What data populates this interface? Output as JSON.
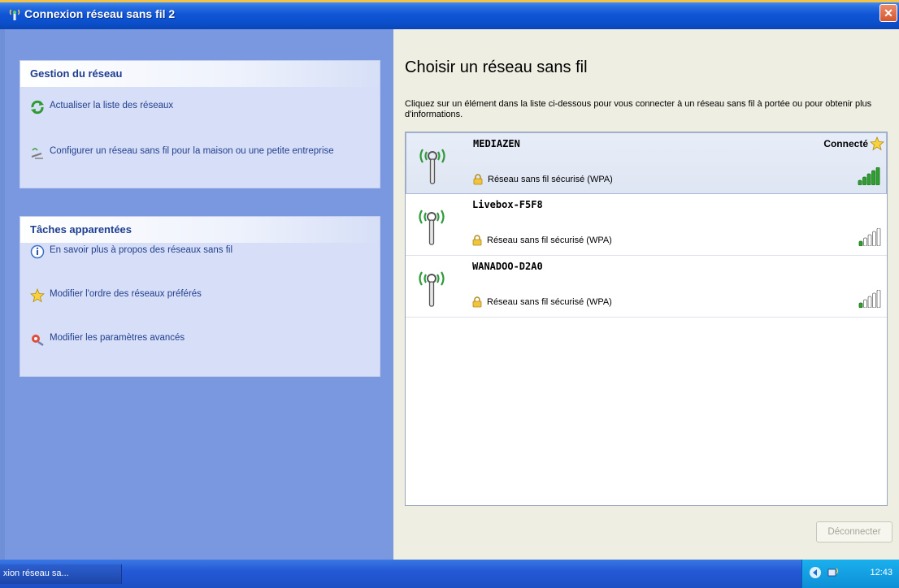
{
  "window": {
    "title": "Connexion réseau sans fil 2",
    "close_symbol": "✕"
  },
  "left": {
    "network_tasks": {
      "title": "Gestion du réseau",
      "items": [
        {
          "label": "Actualiser la liste des réseaux",
          "icon": "refresh-icon"
        },
        {
          "label": "Configurer un réseau sans fil pour la maison ou une petite entreprise",
          "icon": "wizard-icon"
        }
      ]
    },
    "related_tasks": {
      "title": "Tâches apparentées",
      "items": [
        {
          "label": "En savoir plus à propos des réseaux sans fil",
          "icon": "info-icon"
        },
        {
          "label": "Modifier l'ordre des réseaux préférés",
          "icon": "star-icon"
        },
        {
          "label": "Modifier les paramètres avancés",
          "icon": "settings-icon"
        }
      ]
    }
  },
  "main": {
    "heading": "Choisir un réseau sans fil",
    "instructions": "Cliquez sur un élément dans la liste ci-dessous pour vous connecter à un réseau sans fil à portée ou pour obtenir plus d'informations.",
    "networks": [
      {
        "ssid": "MEDIAZEN",
        "security": "Réseau sans fil sécurisé (WPA)",
        "status": "Connecté",
        "signal_bars": 5,
        "selected": true
      },
      {
        "ssid": "Livebox-F5F8",
        "security": "Réseau sans fil sécurisé (WPA)",
        "status": "",
        "signal_bars": 1,
        "selected": false
      },
      {
        "ssid": "WANADOO-D2A0",
        "security": "Réseau sans fil sécurisé (WPA)",
        "status": "",
        "signal_bars": 1,
        "selected": false
      }
    ],
    "disconnect_label": "Déconnecter"
  },
  "taskbar": {
    "task_label": "xion réseau sa...",
    "clock": "12:43"
  },
  "colors": {
    "signal_on": "#2da12d",
    "signal_off": "#ffffff",
    "antenna": "#2e9a3a"
  }
}
